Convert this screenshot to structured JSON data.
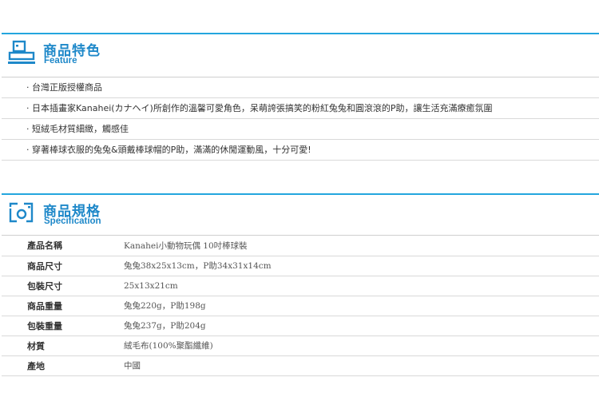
{
  "feature": {
    "title_zh": "商品特色",
    "title_en": "Feature",
    "icon": "printer-icon",
    "bullet": "‧",
    "items": [
      "台灣正版授權商品",
      "日本插畫家Kanahei(カナヘイ)所創作的溫馨可愛角色，呆萌誇張搞笑的粉紅兔兔和圓滾滾的P助，讓生活充滿療癒氛圍",
      "短絨毛材質細緻，觸感佳",
      "穿著棒球衣服的兔兔&頭戴棒球帽的P助，滿滿的休閒運動風，十分可愛!"
    ]
  },
  "spec": {
    "title_zh": "商品規格",
    "title_en": "Specification",
    "icon": "camera-icon",
    "rows": [
      {
        "key": "產品名稱",
        "value": "Kanahei小動物玩偶 10吋棒球裝"
      },
      {
        "key": "商品尺寸",
        "value": "兔兔38x25x13cm，P助34x31x14cm"
      },
      {
        "key": "包裝尺寸",
        "value": "25x13x21cm"
      },
      {
        "key": "商品重量",
        "value": "兔兔220g，P助198g"
      },
      {
        "key": "包裝重量",
        "value": "兔兔237g，P助204g"
      },
      {
        "key": "材質",
        "value": "絨毛布(100%聚酯纖維)"
      },
      {
        "key": "產地",
        "value": "中國"
      }
    ]
  },
  "colors": {
    "accent": "#24a6de",
    "title": "#1e88c9",
    "divider": "#d9d9d9"
  }
}
